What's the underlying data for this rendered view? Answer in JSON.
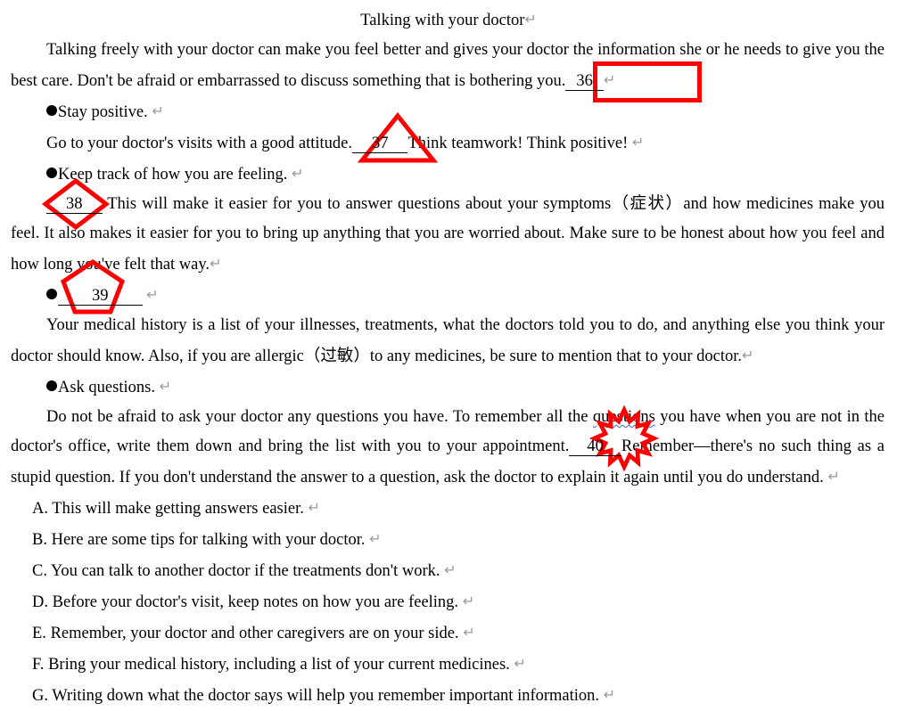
{
  "document": {
    "title": "Talking with your doctor",
    "return_glyph": "↵",
    "accent_color": "#ff0000",
    "spellcheck_underline_color": "#3a63c8",
    "body_text_color": "#000000",
    "return_glyph_color": "#9a9a9a"
  },
  "paragraphs": {
    "p1_a": "Talking freely with your doctor can make you feel better and gives your doctor the information she or he needs to give you the best care. Don't be afraid or embarrassed to discuss something that is bothering you.",
    "bullet1": "Stay positive.",
    "p2_a": "Go to your doctor's visits with a good attitude.",
    "p2_b": "Think teamwork! Think positive!",
    "bullet2": "Keep track of how you are feeling.",
    "p3_b": "This will make it easier for you to answer questions about your symptoms（症状）and how medicines make you feel. It also makes it easier for you to bring up anything that you are worried about. Make sure to be honest about how you feel and how long you've felt that way.",
    "p4_a": "Your medical history is a list of your illnesses, treatments, what the doctors told you to do, and anything else you think your doctor should know. Also, if you are allergic（过敏）to any medicines, be sure to mention that to your doctor.",
    "bullet3": "Ask questions.",
    "p5_a": "Do not be afraid to ask your doctor any questions you have. To remember all the ",
    "p5_squiggle": "questions",
    "p5_b": " you have when you are not in the doctor's office, write them down and bring the list with you to your appointment.",
    "p5_c": "Remember—there's no such thing as a stupid question. If you don't understand the answer to a question, ask the doctor to explain it again until you do understand."
  },
  "blanks": [
    {
      "number": "36",
      "shape": "rectangle"
    },
    {
      "number": "37",
      "shape": "triangle"
    },
    {
      "number": "38",
      "shape": "diamond"
    },
    {
      "number": "39",
      "shape": "pentagon"
    },
    {
      "number": "40",
      "shape": "explosion-star"
    }
  ],
  "options": [
    {
      "letter": "A.",
      "text": "This will make getting answers easier."
    },
    {
      "letter": "B.",
      "text": "Here are some tips for talking with your doctor."
    },
    {
      "letter": "C.",
      "text": "You can talk to another doctor if the treatments don't work."
    },
    {
      "letter": "D.",
      "text": "Before your doctor's visit, keep notes on how you are feeling."
    },
    {
      "letter": "E.",
      "text": "Remember, your doctor and other caregivers are on your side."
    },
    {
      "letter": "F.",
      "text": "Bring your medical history, including a list of your current medicines."
    },
    {
      "letter": "G.",
      "text": "Writing down what the doctor says will help you remember important information."
    }
  ]
}
